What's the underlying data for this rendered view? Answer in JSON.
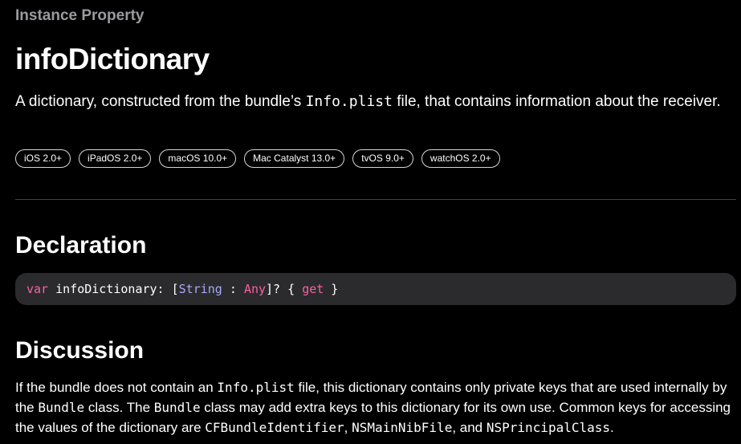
{
  "eyebrow": "Instance Property",
  "title": "infoDictionary",
  "abstract": {
    "before": "A dictionary, constructed from the bundle’s ",
    "code": "Info.plist",
    "after": " file, that contains information about the receiver."
  },
  "availability": [
    "iOS 2.0+",
    "iPadOS 2.0+",
    "macOS 10.0+",
    "Mac Catalyst 13.0+",
    "tvOS 9.0+",
    "watchOS 2.0+"
  ],
  "declaration": {
    "heading": "Declaration",
    "tokens": {
      "var": "var",
      "name": " infoDictionary: [",
      "type1": "String",
      "sep": " : ",
      "type2": "Any",
      "close": "]? { ",
      "get": "get",
      "end": " }"
    }
  },
  "discussion": {
    "heading": "Discussion",
    "parts": {
      "p1": "If the bundle does not contain an ",
      "c1": "Info.plist",
      "p2": " file, this dictionary contains only private keys that are used internally by the ",
      "c2": "Bundle",
      "p3": " class. The ",
      "c3": "Bundle",
      "p4": " class may add extra keys to this dictionary for its own use. Common keys for accessing the values of the dictionary are ",
      "c4": "CFBundleIdentifier",
      "p5": ", ",
      "c5": "NSMainNibFile",
      "p6": ", and ",
      "c6": "NSPrincipalClass",
      "p7": "."
    }
  },
  "colors": {
    "background": "#000000",
    "eyebrow": "#9a9a9f",
    "keyword": "#fc5fa3",
    "type": "#a8a8f8",
    "code_background": "#2b2b2e",
    "divider": "#424245"
  }
}
